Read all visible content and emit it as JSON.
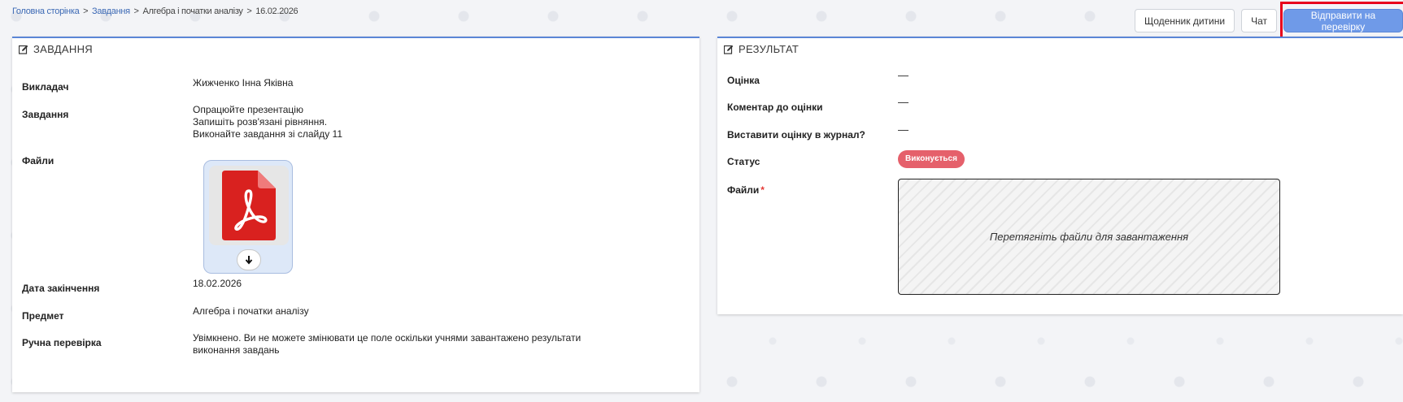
{
  "breadcrumb": {
    "home": "Головна сторінка",
    "tasks": "Завдання",
    "subject": "Алгебра і початки аналізу",
    "date": "16.02.2026",
    "separator": ">"
  },
  "actions": {
    "diary": "Щоденник дитини",
    "chat": "Чат",
    "submit": "Відправити на перевірку"
  },
  "task_panel": {
    "title": "ЗАВДАННЯ",
    "teacher_label": "Викладач",
    "teacher_value": "Жижченко Інна Яківна",
    "task_label": "Завдання",
    "task_lines": [
      "Опрацюйте презентацію",
      "Запишіть розв'язані рівняння.",
      "Виконайте завдання зі слайду 11"
    ],
    "files_label": "Файли",
    "file_icon": "pdf-icon",
    "deadline_label": "Дата закінчення",
    "deadline_value": "18.02.2026",
    "subject_label": "Предмет",
    "subject_value": "Алгебра і початки аналізу",
    "manual_label": "Ручна перевірка",
    "manual_value_1": "Увімкнено. Ви не можете змінювати це поле оскільки учнями завантажено результати",
    "manual_value_2": "виконання завдань"
  },
  "result_panel": {
    "title": "РЕЗУЛЬТАТ",
    "grade_label": "Оцінка",
    "grade_value": "—",
    "comment_label": "Коментар до оцінки",
    "comment_value": "—",
    "journal_label": "Виставити оцінку в журнал?",
    "journal_value": "—",
    "status_label": "Статус",
    "status_value": "Виконується",
    "files_label": "Файли",
    "required_mark": "*",
    "dropzone_text": "Перетягніть файли для завантаження"
  },
  "colors": {
    "accent": "#5b86d6",
    "primary_button": "#6f9ae8",
    "status_badge": "#e5606b",
    "highlight": "#e8001c",
    "pdf_red": "#d9211f"
  }
}
